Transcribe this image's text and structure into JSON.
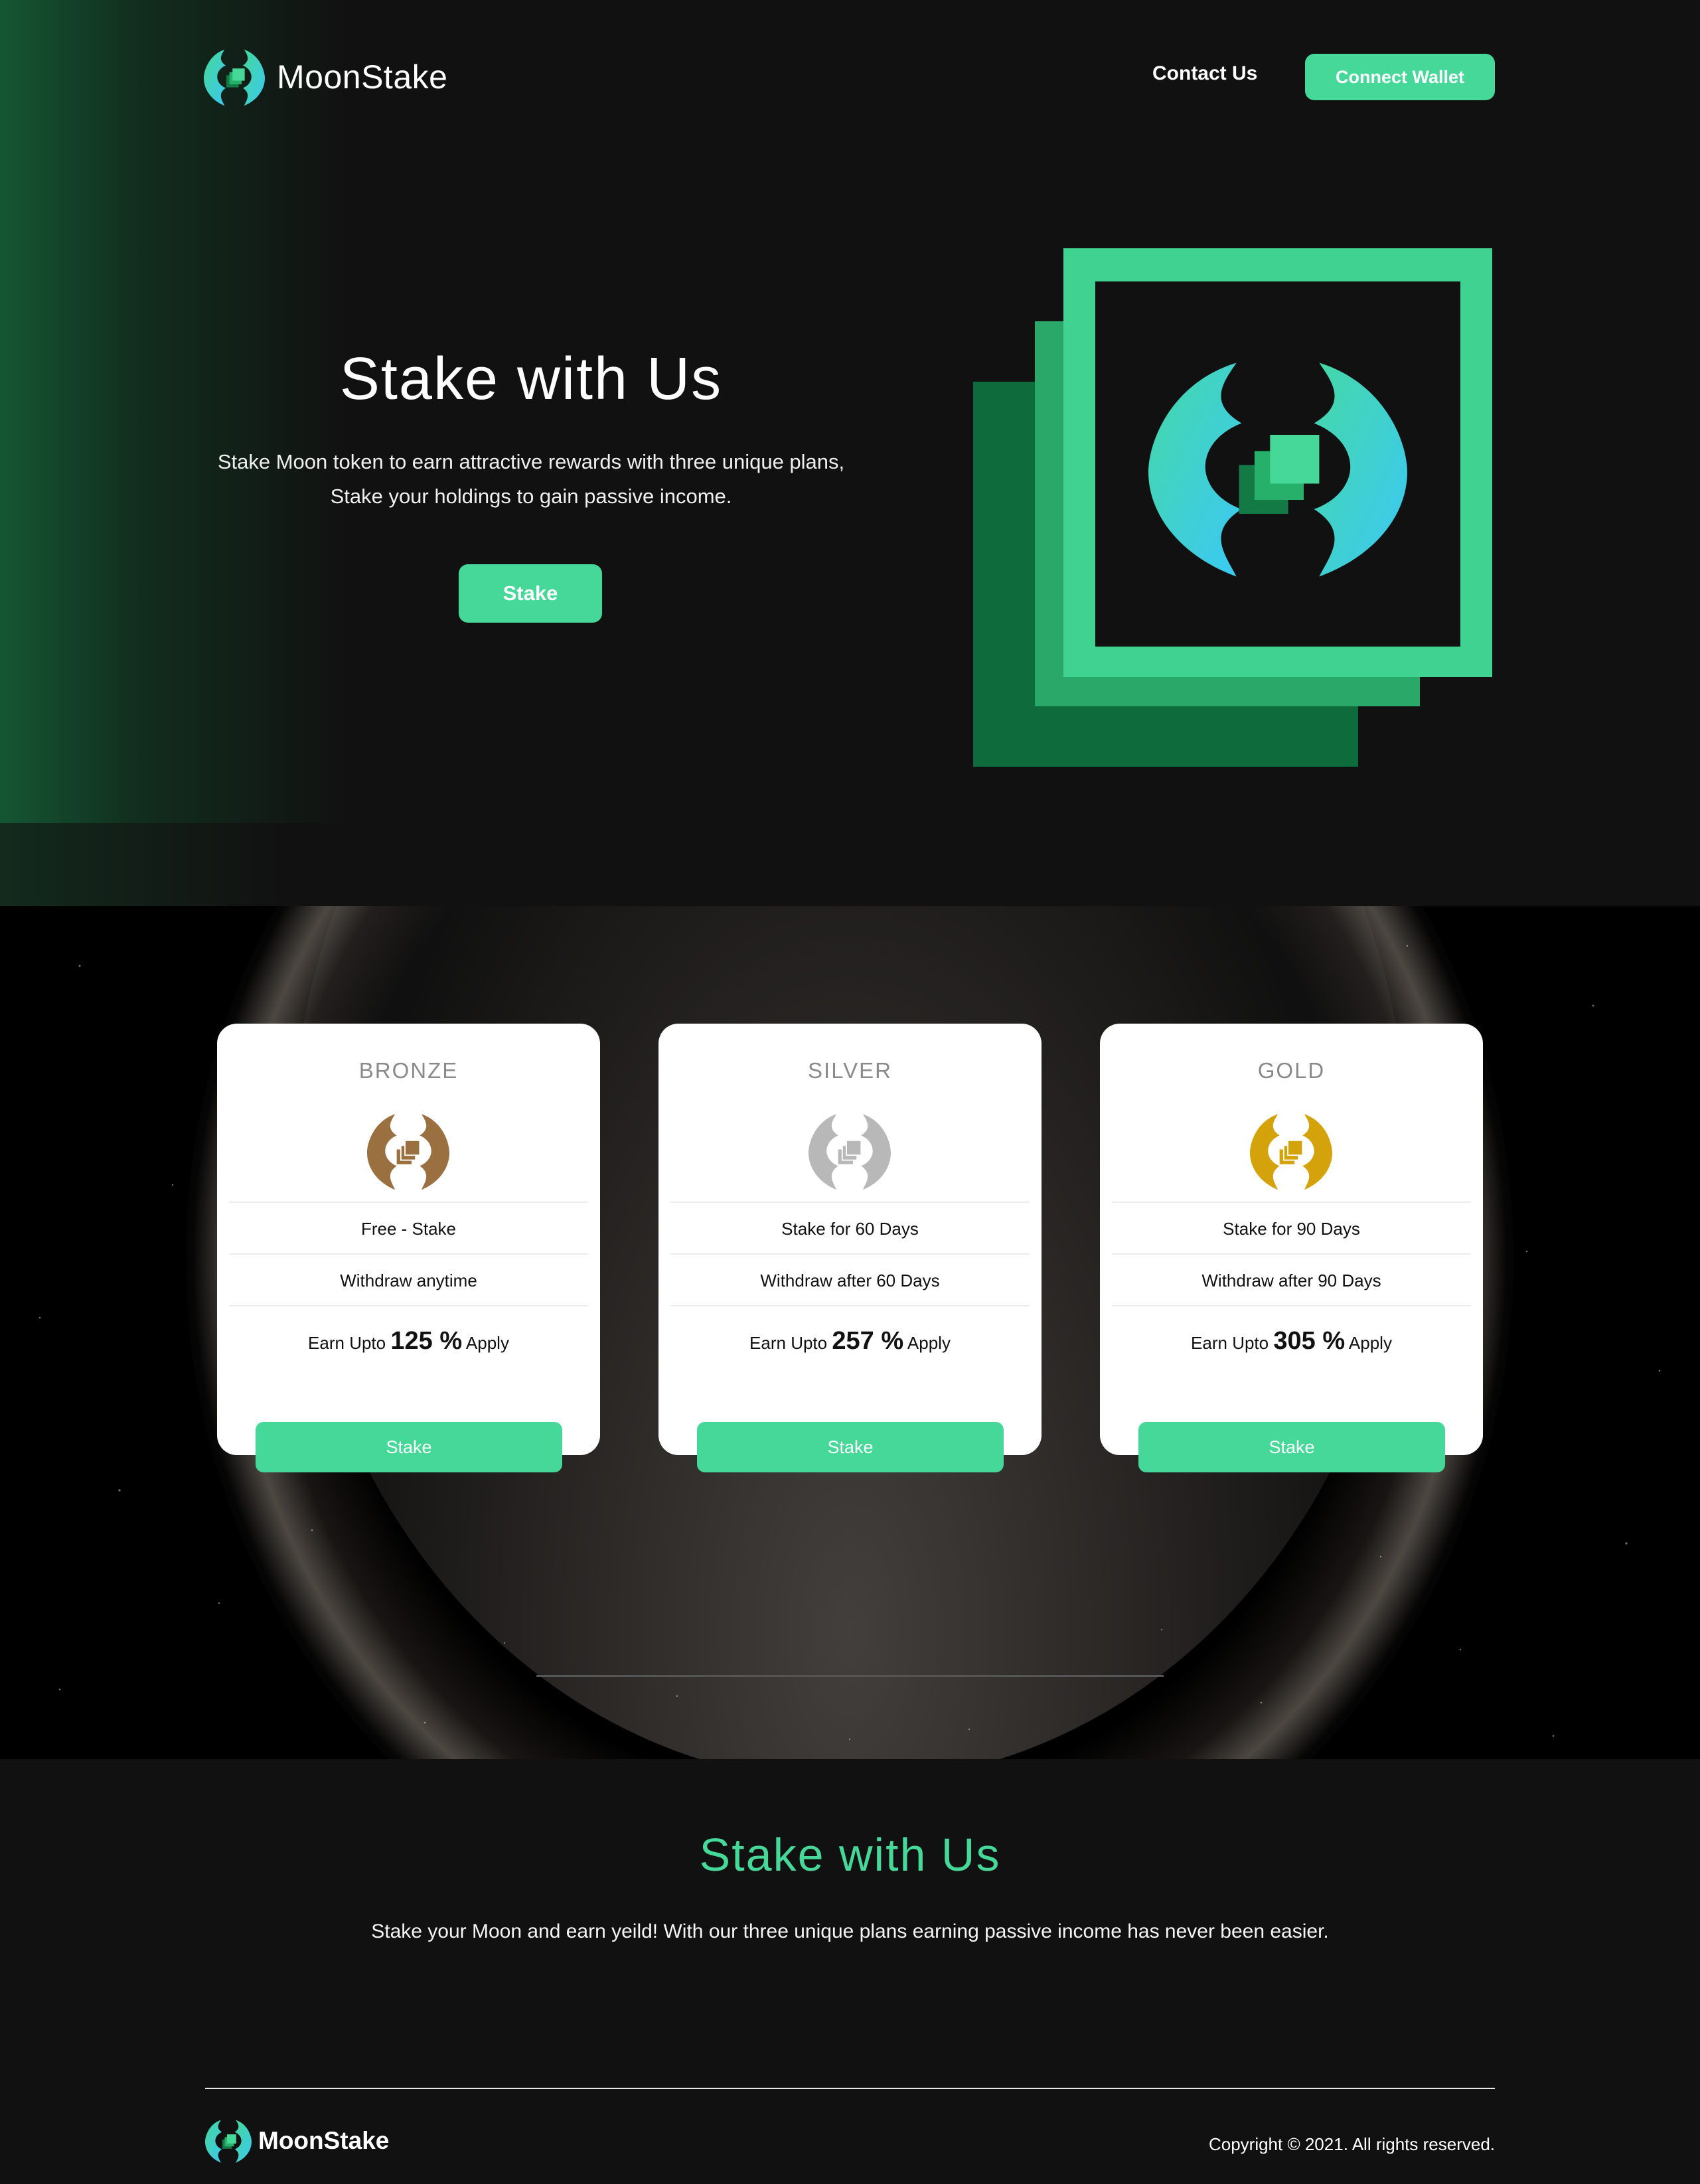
{
  "header": {
    "brand": "MoonStake",
    "nav_contact": "Contact Us",
    "connect_wallet": "Connect Wallet"
  },
  "hero": {
    "title": "Stake with Us",
    "subtitle": "Stake Moon token to earn attractive rewards with three unique plans, Stake your holdings to gain passive income.",
    "cta": "Stake"
  },
  "plans": [
    {
      "tier": "BRONZE",
      "icon": "bronze-moon-icon",
      "color": "#9b7040",
      "row1": "Free - Stake",
      "row2": "Withdraw anytime",
      "earn_prefix": "Earn Upto",
      "earn_value": "125 %",
      "earn_suffix": "Apply",
      "button": "Stake"
    },
    {
      "tier": "SILVER",
      "icon": "silver-moon-icon",
      "color": "#b8b8b8",
      "row1": "Stake for 60 Days",
      "row2": "Withdraw after 60 Days",
      "earn_prefix": "Earn Upto",
      "earn_value": "257 %",
      "earn_suffix": "Apply",
      "button": "Stake"
    },
    {
      "tier": "GOLD",
      "icon": "gold-moon-icon",
      "color": "#d4a20a",
      "row1": "Stake for 90 Days",
      "row2": "Withdraw after 90 Days",
      "earn_prefix": "Earn Upto",
      "earn_value": "305 %",
      "earn_suffix": "Apply",
      "button": "Stake"
    }
  ],
  "about": {
    "title": "Stake with Us",
    "subtitle": "Stake your Moon and earn yeild! With our three unique plans earning passive income has never been easier."
  },
  "footer": {
    "brand": "MoonStake",
    "copyright": "Copyright © 2021. All rights reserved."
  },
  "colors": {
    "accent": "#45d898",
    "background": "#111111",
    "plans_background": "#000000",
    "card": "#ffffff"
  }
}
